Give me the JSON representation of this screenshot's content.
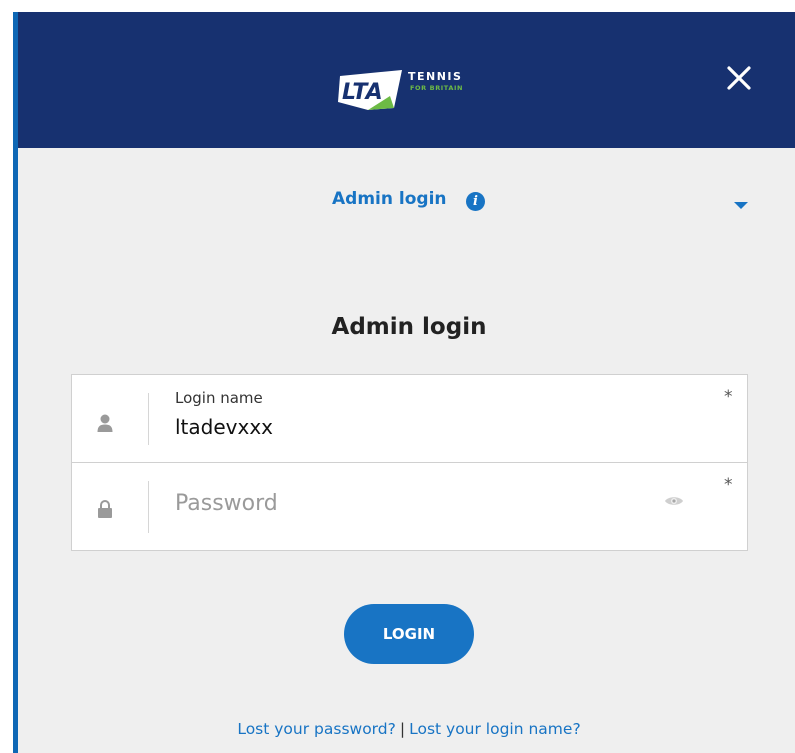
{
  "brand": {
    "logo_letters": "LTA",
    "logo_word": "TENNIS",
    "logo_tagline": "FOR BRITAIN"
  },
  "header": {
    "close_glyph": "×"
  },
  "selector": {
    "label": "Admin login",
    "info_glyph": "i"
  },
  "form": {
    "title": "Admin login",
    "login_name": {
      "label": "Login name",
      "value": "ltadevxxx",
      "required_mark": "*"
    },
    "password": {
      "placeholder": "Password",
      "required_mark": "*"
    },
    "submit_label": "LOGIN"
  },
  "footer": {
    "lost_password": "Lost your password?",
    "separator": "|",
    "lost_login_name": "Lost your login name?"
  },
  "colors": {
    "header_bg": "#173170",
    "accent": "#1874c4",
    "brand_green": "#6dbb45",
    "modal_bg": "#efefef"
  },
  "icons": {
    "close": "close-icon",
    "info": "info-icon",
    "dropdown": "chevron-down-icon",
    "user": "user-icon",
    "lock": "lock-icon",
    "eye": "eye-icon"
  }
}
